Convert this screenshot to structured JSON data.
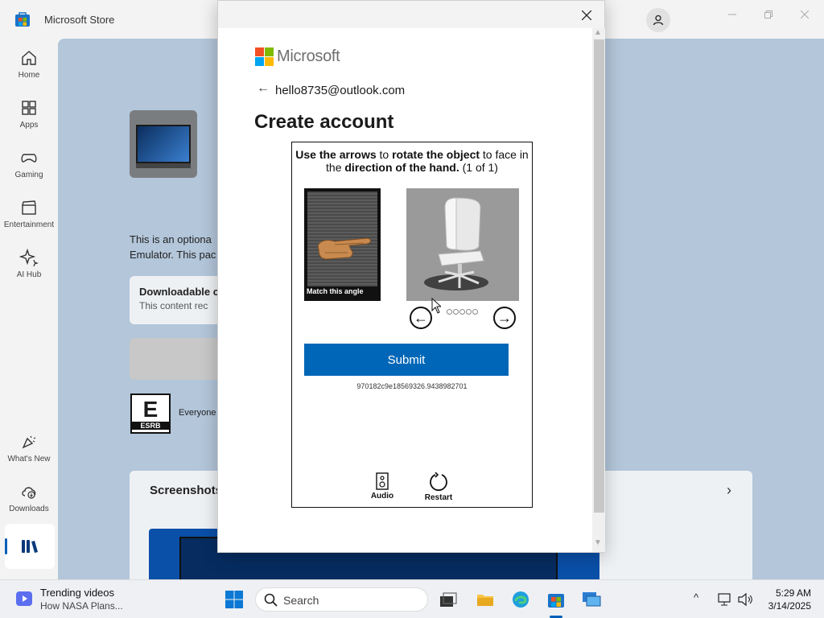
{
  "store": {
    "title": "Microsoft Store",
    "nav": [
      {
        "label": "Home",
        "icon": "home-icon"
      },
      {
        "label": "Apps",
        "icon": "apps-icon"
      },
      {
        "label": "Gaming",
        "icon": "gaming-icon"
      },
      {
        "label": "Entertainment",
        "icon": "entertainment-icon"
      },
      {
        "label": "AI Hub",
        "icon": "ai-hub-icon"
      },
      {
        "label": "What's New",
        "icon": "whats-new-icon"
      },
      {
        "label": "Downloads",
        "icon": "downloads-icon"
      },
      {
        "label": "",
        "icon": "library-icon"
      }
    ],
    "description_line1": "This is an optiona",
    "description_line2": "Emulator. This pac",
    "downloadable_title": "Downloadable c",
    "downloadable_sub": "This content rec",
    "rating_text": "Everyone",
    "esrb_letter": "E",
    "esrb_word": "ESRB",
    "screenshots_title": "Screenshots"
  },
  "dialog": {
    "brand": "Microsoft",
    "email": "hello8735@outlook.com",
    "heading": "Create account",
    "captcha": {
      "instr_1": "Use the arrows",
      "instr_2": " to ",
      "instr_3": "rotate the object",
      "instr_4": " to face in the ",
      "instr_5": "direction of the hand.",
      "instr_6": " (1 of 1)",
      "match_caption": "Match this angle",
      "submit_label": "Submit",
      "session_id": "970182c9e18569326.9438982701",
      "audio_label": "Audio",
      "restart_label": "Restart",
      "total_dots": 5
    }
  },
  "taskbar": {
    "news_title": "Trending videos",
    "news_subtitle": "How NASA Plans...",
    "search_placeholder": "Search",
    "time": "5:29 AM",
    "date": "3/14/2025"
  },
  "colors": {
    "accent": "#0067b8",
    "store_accent": "#005fb8",
    "ms_red": "#f25022",
    "ms_green": "#7fba00",
    "ms_blue": "#00a4ef",
    "ms_yellow": "#ffb900"
  }
}
